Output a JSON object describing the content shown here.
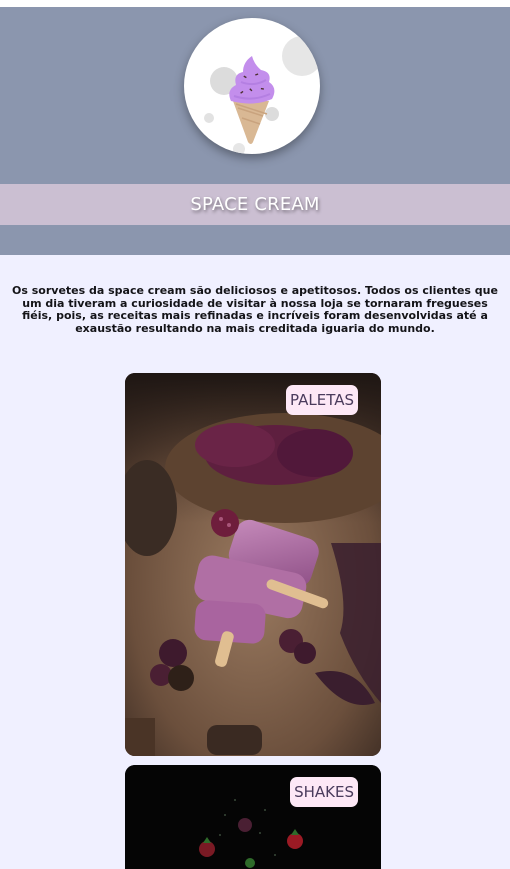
{
  "header": {
    "logo_icon": "ice-cream-cone-icon",
    "title": "SPACE CREAM",
    "colors": {
      "header_bg": "#8b96ae",
      "title_band": "#cbbfd2",
      "page_bg": "#f0f0ff"
    }
  },
  "intro": {
    "text": "Os sorvetes da space cream são deliciosos e apetitosos. Todos os clientes que um dia tiveram a curiosidade de visitar à nossa loja se tornaram fregueses fiéis, pois, as receitas mais refinadas e incríveis foram desenvolvidas até a exaustão resultando na mais creditada iguaria do mundo."
  },
  "products": [
    {
      "label": "PALETAS",
      "image": "purple-popsicles-photo"
    },
    {
      "label": "SHAKES",
      "image": "berries-dark-photo"
    }
  ],
  "colors": {
    "label_bg": "#fde8f6",
    "label_text": "#4a3b5c"
  }
}
